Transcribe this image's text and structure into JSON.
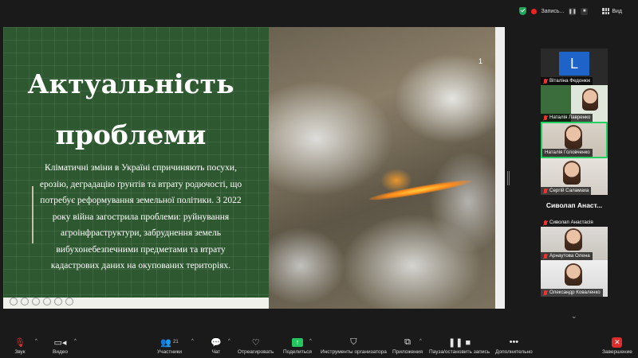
{
  "topbar": {
    "recording_label": "Запись...",
    "view_label": "Вид"
  },
  "slide": {
    "title_line1": "Актуальність",
    "title_line2": "проблеми",
    "body": "Кліматичні зміни в Україні спричиняють посухи, ерозію, деградацію ґрунтів та втрату родючості, що потребує реформування земельної політики. З 2022 року війна загострила проблеми: руйнування агроінфраструктури, забруднення земель вибухонебезпечними предметами та втрату кадастрових даних на окупованих територіях.",
    "page_number": "1"
  },
  "participants": [
    {
      "name": "Віталіна Федонюк",
      "avatar": "L",
      "type": "avatar"
    },
    {
      "name": "Наталія Лавренко",
      "type": "video"
    },
    {
      "name": "Наталія Головченко",
      "type": "video",
      "active": true
    },
    {
      "name": "Сергій Саламаха",
      "type": "video"
    },
    {
      "heading": "Сиволап  Анаст...",
      "name": "Сиволап Анастасія",
      "type": "name-only"
    },
    {
      "name": "Арнаутова Олена",
      "type": "video"
    },
    {
      "name": "Олександр Коваленко",
      "type": "video"
    }
  ],
  "toolbar": {
    "audio": "Звук",
    "video": "Видео",
    "participants": "Участники",
    "participants_count": "21",
    "chat": "Чат",
    "react": "Отреагировать",
    "share": "Поделиться",
    "host_tools": "Инструменты организатора",
    "apps": "Приложения",
    "pause_recording": "Пауза/остановить запись",
    "more": "Дополнительно",
    "end": "Завершение"
  },
  "colors": {
    "slide_green": "#2e5930",
    "active_border": "#23d160",
    "share_green": "#23c55e",
    "end_red": "#e02b2b"
  }
}
